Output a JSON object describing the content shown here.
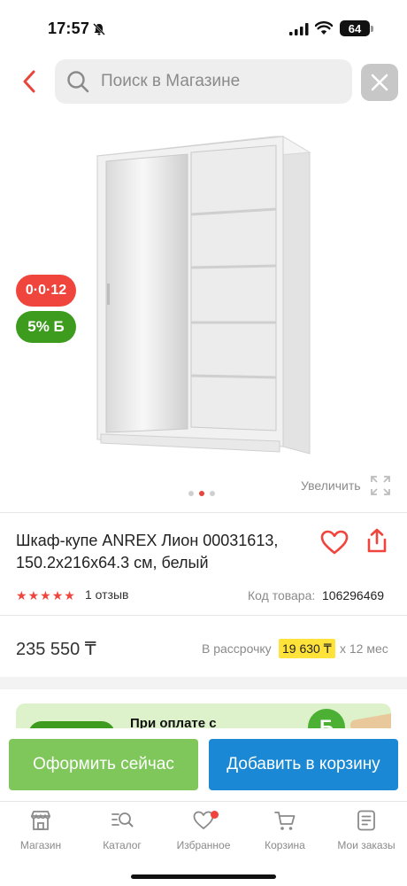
{
  "status_bar": {
    "time": "17:57",
    "battery": "64"
  },
  "header": {
    "search_placeholder": "Поиск в Магазине"
  },
  "gallery": {
    "badge_installment": "0·0·12",
    "badge_bonus": "5% Б",
    "zoom_label": "Увеличить",
    "slides_total": 3,
    "active_slide": 2
  },
  "product": {
    "title": "Шкаф-купе ANREX Лион 00031613, 150.2x216x64.3 см, белый",
    "rating": 5,
    "review_count": "1 отзыв",
    "sku_label": "Код товара:",
    "sku_value": "106296469"
  },
  "pricing": {
    "price": "235 550 ₸",
    "installment_label": "В рассрочку",
    "installment_amount": "19 630 ₸",
    "installment_term": "x 12 мес"
  },
  "promo": {
    "text": "При оплате с"
  },
  "actions": {
    "buy_now": "Оформить сейчас",
    "add_to_cart": "Добавить в корзину"
  },
  "tabs": [
    {
      "label": "Магазин",
      "icon": "shop-icon"
    },
    {
      "label": "Каталог",
      "icon": "catalog-search-icon"
    },
    {
      "label": "Избранное",
      "icon": "heart-icon",
      "has_notification": true
    },
    {
      "label": "Корзина",
      "icon": "cart-icon"
    },
    {
      "label": "Мои заказы",
      "icon": "orders-icon"
    }
  ],
  "colors": {
    "accent_red": "#f0453d",
    "bonus_green": "#3d9b1d",
    "buy_green": "#7fc75a",
    "cart_blue": "#1a88d4",
    "installment_yellow": "#ffe23a"
  }
}
